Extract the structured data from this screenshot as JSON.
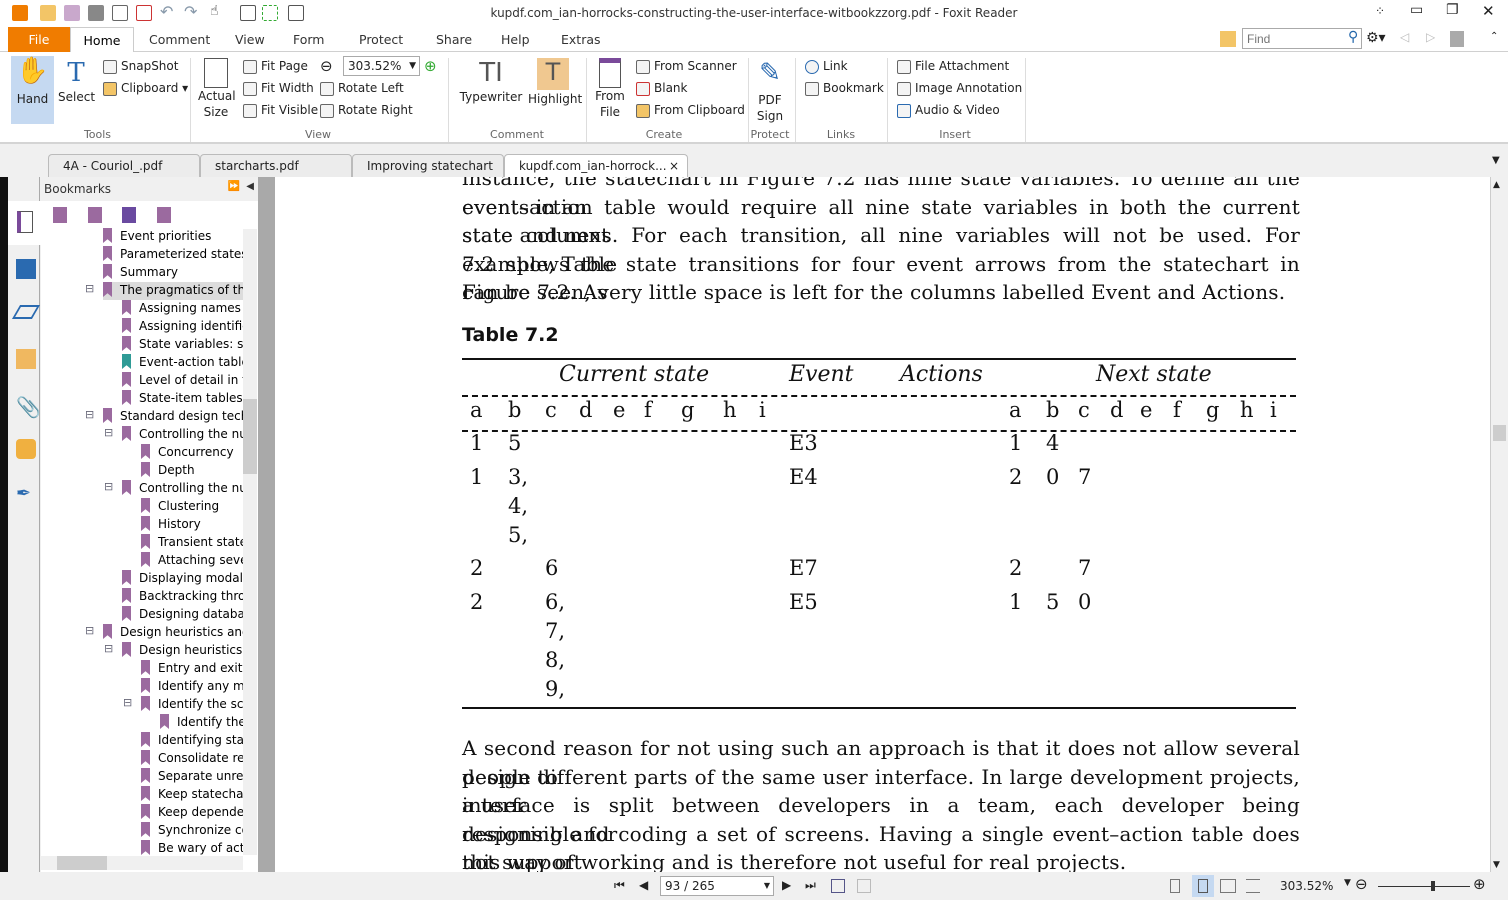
{
  "window": {
    "title": "kupdf.com_ian-horrocks-constructing-the-user-interface-witbookzzorg.pdf - Foxit Reader"
  },
  "ribbon_tabs": [
    "File",
    "Home",
    "Comment",
    "View",
    "Form",
    "Protect",
    "Share",
    "Help",
    "Extras"
  ],
  "find": {
    "placeholder": "Find"
  },
  "ribbon": {
    "tools": {
      "hand": "Hand",
      "select": "Select",
      "snapshot": "SnapShot",
      "clipboard": "Clipboard",
      "group": "Tools"
    },
    "view": {
      "actual_size": "Actual Size",
      "fit_page": "Fit Page",
      "fit_width": "Fit Width",
      "fit_visible": "Fit Visible",
      "zoom": "303.52%",
      "rotate_left": "Rotate Left",
      "rotate_right": "Rotate Right",
      "group": "View"
    },
    "comment": {
      "typewriter": "Typewriter",
      "highlight": "Highlight",
      "group": "Comment"
    },
    "create": {
      "from_file": "From File",
      "from_scanner": "From Scanner",
      "blank": "Blank",
      "from_clipboard": "From Clipboard",
      "group": "Create"
    },
    "protect": {
      "pdf_sign": "PDF Sign",
      "group": "Protect"
    },
    "links": {
      "link": "Link",
      "bookmark": "Bookmark",
      "group": "Links"
    },
    "insert": {
      "file_attachment": "File Attachment",
      "image_annotation": "Image Annotation",
      "audio_video": "Audio & Video",
      "group": "Insert"
    }
  },
  "doc_tabs": [
    "4A - Couriol_.pdf",
    "starcharts.pdf",
    "Improving statechart ...",
    "kupdf.com_ian-horrock..."
  ],
  "bookmarks": {
    "title": "Bookmarks",
    "items": [
      {
        "label": "Event priorities",
        "level": 0
      },
      {
        "label": "Parameterized states",
        "level": 0
      },
      {
        "label": "Summary",
        "level": 0
      },
      {
        "label": "The pragmatics of the",
        "level": 0,
        "expanded": true,
        "selected": true
      },
      {
        "label": "Assigning names t",
        "level": 1
      },
      {
        "label": "Assigning identifier",
        "level": 1
      },
      {
        "label": "State variables: sta",
        "level": 1
      },
      {
        "label": "Event-action table",
        "level": 1,
        "current": true
      },
      {
        "label": "Level of detail in th",
        "level": 1
      },
      {
        "label": "State-item tables",
        "level": 1
      },
      {
        "label": "Standard design techn",
        "level": 0,
        "expanded": true
      },
      {
        "label": "Controlling the nur",
        "level": 1,
        "expanded": true
      },
      {
        "label": "Concurrency",
        "level": 2
      },
      {
        "label": "Depth",
        "level": 2
      },
      {
        "label": "Controlling the nur",
        "level": 1,
        "expanded": true
      },
      {
        "label": "Clustering",
        "level": 2
      },
      {
        "label": "History",
        "level": 2
      },
      {
        "label": "Transient state",
        "level": 2
      },
      {
        "label": "Attaching seve",
        "level": 2
      },
      {
        "label": "Displaying modal al",
        "level": 1
      },
      {
        "label": "Backtracking throu",
        "level": 1
      },
      {
        "label": "Designing databas",
        "level": 1
      },
      {
        "label": "Design heuristics and",
        "level": 0,
        "expanded": true
      },
      {
        "label": "Design heuristics",
        "level": 1,
        "expanded": true
      },
      {
        "label": "Entry and exit",
        "level": 2
      },
      {
        "label": "Identify any m",
        "level": 2
      },
      {
        "label": "Identify the sc",
        "level": 2,
        "expanded": true
      },
      {
        "label": "Identify the",
        "level": 3
      },
      {
        "label": "Identifying stat",
        "level": 2
      },
      {
        "label": "Consolidate rel",
        "level": 2
      },
      {
        "label": "Separate unrel",
        "level": 2
      },
      {
        "label": "Keep statechar",
        "level": 2
      },
      {
        "label": "Keep depende",
        "level": 2
      },
      {
        "label": "Synchronize co",
        "level": 2
      },
      {
        "label": "Be wary of act",
        "level": 2
      }
    ]
  },
  "document": {
    "para1_lines": [
      "instance, the statechart in Figure 7.2 has nine state variables. To define all the events in an",
      "event–action table would require all nine state variables in both the current state and next",
      "state columns. For each transition, all nine variables will not be used. For example, Table",
      "7.2 shows the state transitions for four event arrows from the statechart in Figure 7.2. As",
      "can be seen, very little space is left for the columns labelled Event and Actions."
    ],
    "table": {
      "caption": "Table 7.2",
      "headers": {
        "current": "Current state",
        "event": "Event",
        "actions": "Actions",
        "next": "Next state"
      },
      "vars": [
        "a",
        "b",
        "c",
        "d",
        "e",
        "f",
        "g",
        "h",
        "i"
      ],
      "rows": [
        {
          "current": {
            "a": "1",
            "b": "5"
          },
          "event": "E3",
          "next": {
            "a": "1",
            "b": "4"
          }
        },
        {
          "current": {
            "a": "1",
            "b": "3,|4,|5,"
          },
          "event": "E4",
          "next": {
            "a": "2",
            "b": "0",
            "c": "7"
          }
        },
        {
          "current": {
            "a": "2",
            "c": "6"
          },
          "event": "E7",
          "next": {
            "a": "2",
            "c": "7"
          }
        },
        {
          "current": {
            "a": "2",
            "c": "6,|7,|8,|9,"
          },
          "event": "E5",
          "next": {
            "a": "1",
            "b": "5",
            "c": "0"
          }
        }
      ]
    },
    "para2_lines": [
      "A second reason for not using such an approach is that it does not allow several people to",
      "design different parts of the same user interface. In large development projects, a user",
      "interface is split between developers in a team, each developer being responsible for",
      "designing and coding a set of screens. Having a single event–action table does not support",
      "this way of working and is therefore not useful for real projects."
    ]
  },
  "status": {
    "page": "93 / 265",
    "zoom": "303.52%",
    "zoom_slider_fraction": 0.6
  },
  "colors": {
    "file_tab": "#f07c00",
    "bookmark": "#9b6a9f",
    "bookmark_current": "#2f9b96",
    "hand_active": "#c5d9f1"
  }
}
